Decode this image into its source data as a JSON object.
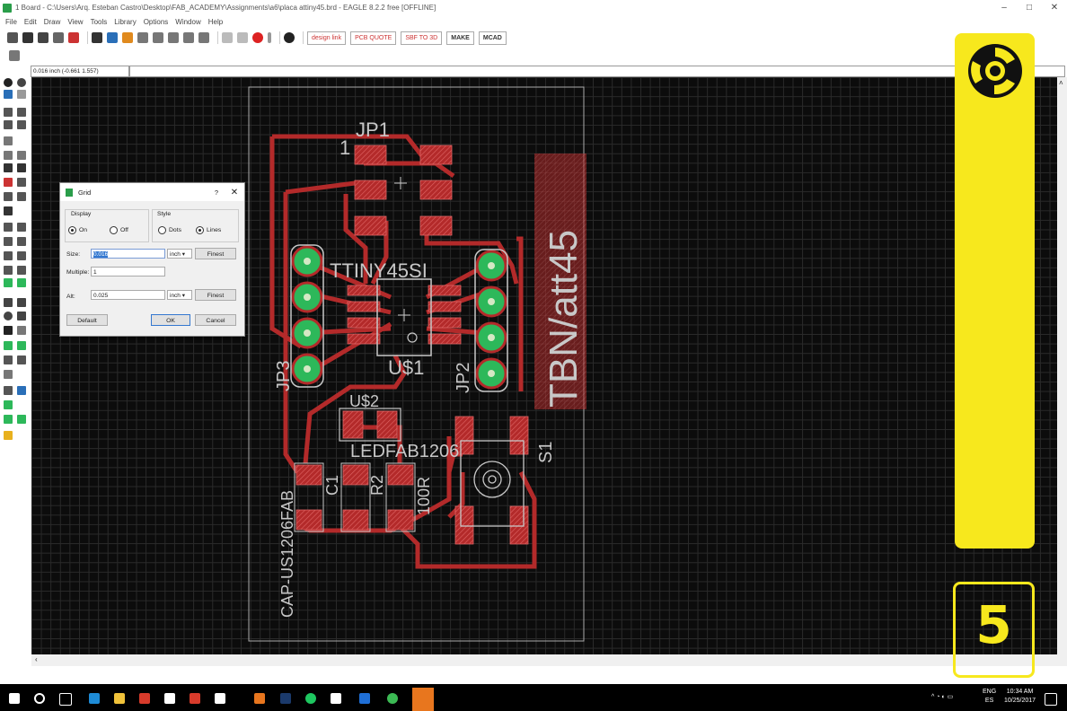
{
  "window": {
    "title": "1 Board - C:\\Users\\Arq. Esteban Castro\\Desktop\\FAB_ACADEMY\\Assignments\\a6\\placa attiny45.brd - EAGLE 8.2.2 free [OFFLINE]",
    "minimize": "–",
    "maximize": "□",
    "close": "✕"
  },
  "menu": [
    "File",
    "Edit",
    "Draw",
    "View",
    "Tools",
    "Library",
    "Options",
    "Window",
    "Help"
  ],
  "toolbar": {
    "design_link": "design link",
    "pcb_quote": "PCB QUOTE",
    "sbf": "SBF TO 3D",
    "make": "MAKE",
    "mcad": "MCAD"
  },
  "coordinates": "0.016 inch (-0.661 1.557)",
  "board": {
    "labels": {
      "jp1": "JP1",
      "pin1": "1",
      "ttiny": "TTINY45SI",
      "u1": "U$1",
      "jp2": "JP2",
      "jp3": "JP3",
      "u2": "U$2",
      "led": "LEDFAB1206",
      "c1": "C1",
      "r2": "R2",
      "ohm": "100R",
      "cap": "CAP-US1206FAB",
      "s1": "S1",
      "tbn": "TBN/att45"
    }
  },
  "grid_dialog": {
    "title": "Grid",
    "help": "?",
    "close": "✕",
    "display_label": "Display",
    "display_on": "On",
    "display_off": "Off",
    "style_label": "Style",
    "style_dots": "Dots",
    "style_lines": "Lines",
    "size_label": "Size:",
    "size_value": "0.016",
    "size_unit": "inch",
    "finest_1": "Finest",
    "multiple_label": "Multiple:",
    "multiple_value": "1",
    "alt_label": "Alt:",
    "alt_value": "0.025",
    "alt_unit": "inch",
    "finest_2": "Finest",
    "default_button": "Default",
    "ok_button": "OK",
    "cancel_button": "Cancel"
  },
  "overlay": {
    "number": "5",
    "color": "#f7e81d"
  },
  "taskbar": {
    "lang": "ENG",
    "region": "ES",
    "time": "10:34 AM",
    "date": "10/25/2017"
  },
  "colors": {
    "trace": "#b32a2a",
    "pad_green": "#2db85a",
    "silk": "#c8c8c8",
    "yellow": "#f7e81d"
  }
}
